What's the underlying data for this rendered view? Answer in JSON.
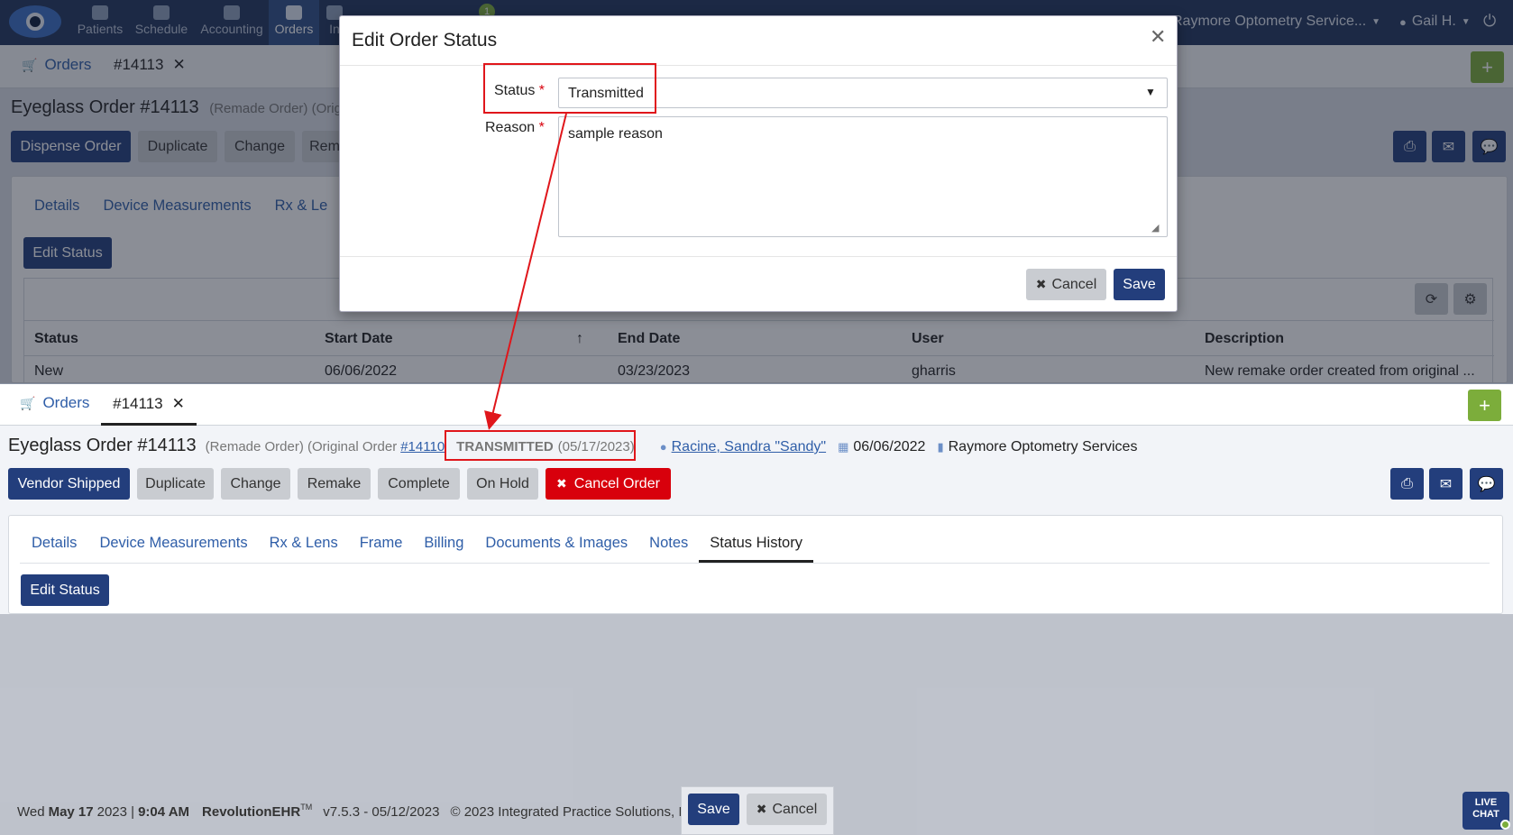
{
  "nav": {
    "items": [
      {
        "label": "Patients"
      },
      {
        "label": "Schedule"
      },
      {
        "label": "Accounting"
      },
      {
        "label": "Orders"
      },
      {
        "label": "In"
      }
    ],
    "messages_badge": "1",
    "practice": "Raymore Optometry Service...",
    "user": "Gail H."
  },
  "bg": {
    "tab_orders": "Orders",
    "tab_order": "#14113",
    "title": "Eyeglass Order #14113",
    "subtitle": "(Remade Order) (Origi",
    "buttons": [
      "Dispense Order",
      "Duplicate",
      "Change",
      "Rem"
    ],
    "tabs": [
      "Details",
      "Device Measurements",
      "Rx & Le"
    ],
    "edit_status": "Edit Status",
    "table": {
      "headers": [
        "Status",
        "Start Date",
        "End Date",
        "User",
        "Description"
      ],
      "row": [
        "New",
        "06/06/2022",
        "03/23/2023",
        "gharris",
        "New remake order created from original ..."
      ]
    }
  },
  "modal": {
    "title": "Edit Order Status",
    "status_label": "Status",
    "status_value": "Transmitted",
    "reason_label": "Reason",
    "reason_value": "sample reason",
    "cancel": "Cancel",
    "save": "Save"
  },
  "fg": {
    "tab_orders": "Orders",
    "tab_order": "#14113",
    "title": "Eyeglass Order #14113",
    "subtitle": "(Remade Order) (Original Order",
    "original_link": "#14110",
    "status": "TRANSMITTED",
    "status_date": "(05/17/2023)",
    "patient": "Racine, Sandra \"Sandy\"",
    "date": "06/06/2022",
    "location": "Raymore Optometry Services",
    "buttons": [
      "Vendor Shipped",
      "Duplicate",
      "Change",
      "Remake",
      "Complete",
      "On Hold",
      "Cancel Order"
    ],
    "tabs": [
      "Details",
      "Device Measurements",
      "Rx & Lens",
      "Frame",
      "Billing",
      "Documents & Images",
      "Notes",
      "Status History"
    ],
    "edit_status": "Edit Status"
  },
  "footer": {
    "day": "Wed",
    "date": "May 17",
    "year": "2023 |",
    "time": "9:04 AM",
    "brand": "RevolutionEHR",
    "tm": "TM",
    "version": "v7.5.3 - 05/12/2023",
    "copyright": "© 2023 Integrated Practice Solutions, I",
    "save": "Save",
    "cancel": "Cancel",
    "live_chat": "LIVE CHAT"
  },
  "colors": {
    "nav": "#21355c",
    "primary": "#233e7c",
    "danger": "#d8000c",
    "add": "#7cad3b",
    "annotation": "#e0161b"
  }
}
